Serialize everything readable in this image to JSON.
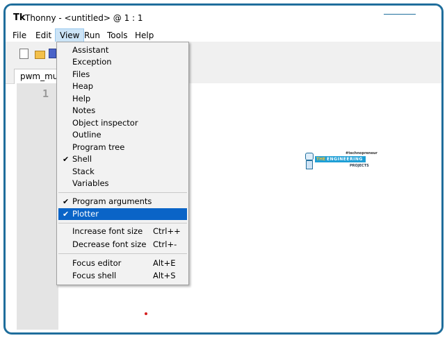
{
  "window": {
    "app_icon": "Tk",
    "title": "Thonny  -  <untitled>  @  1 : 1"
  },
  "menubar": {
    "items": [
      "File",
      "Edit",
      "View",
      "Run",
      "Tools",
      "Help"
    ]
  },
  "toolbar": {
    "icons": [
      "new-file-icon",
      "open-folder-icon",
      "save-icon"
    ]
  },
  "tabs": [
    {
      "label": "pwm_mu"
    }
  ],
  "editor": {
    "line_numbers": [
      "1"
    ]
  },
  "logo": {
    "top_text": "#technopreneur",
    "brand_the": "THE",
    "brand_main": "ENGINEERING",
    "brand_sub": "PROJECTS"
  },
  "view_menu": {
    "items": [
      {
        "label": "Assistant",
        "checked": false,
        "shortcut": ""
      },
      {
        "label": "Exception",
        "checked": false,
        "shortcut": ""
      },
      {
        "label": "Files",
        "checked": false,
        "shortcut": ""
      },
      {
        "label": "Heap",
        "checked": false,
        "shortcut": ""
      },
      {
        "label": "Help",
        "checked": false,
        "shortcut": ""
      },
      {
        "label": "Notes",
        "checked": false,
        "shortcut": ""
      },
      {
        "label": "Object inspector",
        "checked": false,
        "shortcut": ""
      },
      {
        "label": "Outline",
        "checked": false,
        "shortcut": ""
      },
      {
        "label": "Program tree",
        "checked": false,
        "shortcut": ""
      },
      {
        "label": "Shell",
        "checked": true,
        "shortcut": ""
      },
      {
        "label": "Stack",
        "checked": false,
        "shortcut": ""
      },
      {
        "label": "Variables",
        "checked": false,
        "shortcut": ""
      },
      {
        "label": "Program arguments",
        "checked": true,
        "shortcut": ""
      },
      {
        "label": "Plotter",
        "checked": true,
        "shortcut": "",
        "highlighted": true
      },
      {
        "label": "Increase font size",
        "checked": false,
        "shortcut": "Ctrl++"
      },
      {
        "label": "Decrease font size",
        "checked": false,
        "shortcut": "Ctrl+-"
      },
      {
        "label": "Focus editor",
        "checked": false,
        "shortcut": "Alt+E"
      },
      {
        "label": "Focus shell",
        "checked": false,
        "shortcut": "Alt+S"
      }
    ],
    "check_glyph": "✔"
  },
  "colors": {
    "frame_border": "#1f6e9c",
    "menu_highlight": "#0a64c7",
    "active_menu_bg": "#cce4f7",
    "gutter": "#e4e4e4"
  }
}
